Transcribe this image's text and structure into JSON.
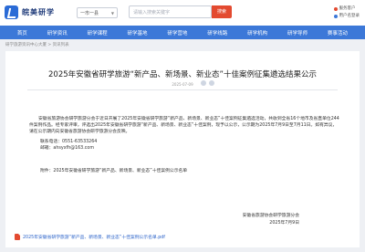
{
  "header": {
    "logo_text": "皖美研学",
    "selector": "一市一县",
    "search_placeholder": "请输入搜索关键字",
    "search_button": "搜索",
    "utils": [
      "服务客户",
      "用户名登录"
    ]
  },
  "nav": {
    "items": [
      "首页",
      "研学资讯",
      "研学课程",
      "研学基地",
      "研学营地",
      "研学线路",
      "研学机构",
      "研学导师",
      "赛事活动"
    ]
  },
  "breadcrumb": "研学旅游资讯中心大厦 > 资讯列表",
  "article": {
    "title": "2025年安徽省研学旅游“新产品、新场景、新业态”十佳案例征集遴选结果公示",
    "date": "2025-07-09",
    "source": "来源：安徽省旅游协会",
    "p1": "安徽省旅游协会研学旅游分会于近日开展了2025年安徽省研学旅游“新产品、新场景、新业态”十佳案例征集遴选活动，共收到全省16个地市及省直单位244件案例作品。经专家评审，评选出2025年安徽省研学旅游“新产品、新场景、新业态”十佳案例，现予以公示，公示期为2025年7月9日至7月11日。如有异议，请在公示期内向安徽省旅游协会研学旅游分会反映。",
    "contact_label": "联系电话：0551-63533264",
    "email_label": "邮箱：ahsyxfh@163.com",
    "attachment_note": "附件：2025年安徽省研学旅游“新产品、新场景、新业态”十佳案例公示名单",
    "sign_org": "安徽省旅游协会研学旅游分会",
    "sign_date": "2025年7月9日",
    "attachment_file": "2025年安徽省研学旅游“新产品、新场景、新业态”十佳案例公示名单.pdf"
  },
  "colors": {
    "nav": "#3c78d8",
    "search_button": "#e34a30",
    "link": "#2a62c9"
  }
}
